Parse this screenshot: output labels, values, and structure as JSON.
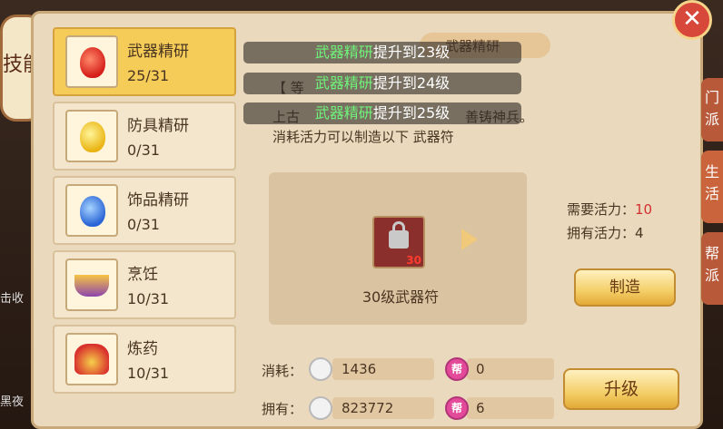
{
  "side": {
    "skills_label": "技能",
    "edge_text_1": "击收",
    "edge_text_2": "黑夜"
  },
  "skills": [
    {
      "name": "武器精研",
      "level": "25/31",
      "icon": "red-flame-icon",
      "color": "#e0322a",
      "active": true
    },
    {
      "name": "防具精研",
      "level": "0/31",
      "icon": "yellow-flame-icon",
      "color": "#f2c31f",
      "active": false
    },
    {
      "name": "饰品精研",
      "level": "0/31",
      "icon": "blue-flame-icon",
      "color": "#3a78e4",
      "active": false
    },
    {
      "name": "烹饪",
      "level": "10/31",
      "icon": "cooking-pot-icon",
      "color": "#9b59b6",
      "active": false
    },
    {
      "name": "炼药",
      "level": "10/31",
      "icon": "alchemy-furnace-icon",
      "color": "#d9322d",
      "active": false
    }
  ],
  "detail": {
    "tab_title": "武器精研",
    "desc_line1": "【 等",
    "desc_line2_a": "上古",
    "desc_line2_b": "善铸神兵。",
    "desc_line3": "消耗活力可以制造以下 武器符"
  },
  "toasts": [
    {
      "highlight": "武器精研",
      "text": "提升到23级"
    },
    {
      "highlight": "武器精研",
      "text": "提升到24级"
    },
    {
      "highlight": "武器精研",
      "text": "提升到25级"
    }
  ],
  "craft": {
    "item_name": "30级武器符",
    "item_level": "30",
    "need_label": "需要活力：",
    "need_value": "10",
    "have_label": "拥有活力：",
    "have_value": "4",
    "make_button": "制造"
  },
  "resources": {
    "cost_label": "消耗：",
    "own_label": "拥有：",
    "cost_silver": "1436",
    "cost_gang": "0",
    "own_silver": "823772",
    "own_gang": "6",
    "gang_glyph": "帮",
    "upgrade_button": "升级"
  },
  "right_tabs": [
    {
      "label": "门派"
    },
    {
      "label": "生活"
    },
    {
      "label": "帮派"
    }
  ],
  "close_glyph": "✕"
}
